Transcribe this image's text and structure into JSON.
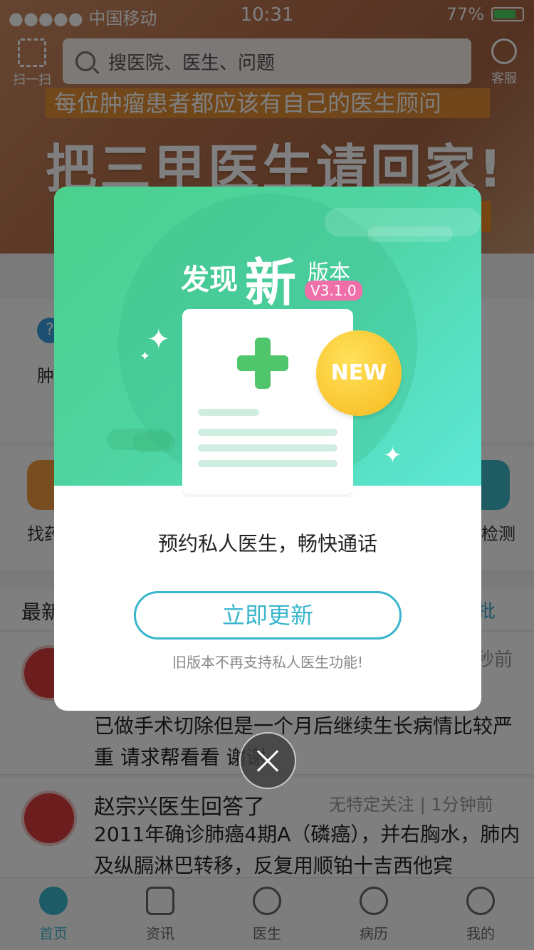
{
  "status": {
    "carrier": "●●●●● 中国移动",
    "time": "10:31",
    "battery": "77%"
  },
  "header": {
    "scan_label": "扫一扫",
    "search_placeholder": "搜医院、医生、问题",
    "service_label": "客服"
  },
  "banner": {
    "slogan": "每位肿瘤患者都应该有自己的医生顾问",
    "title": "把三甲医生请回家!"
  },
  "background": {
    "grid_label_partial": "肿",
    "find_label_partial": "找药",
    "detect_label": "检测",
    "section_title_partial": "最新",
    "refresh_label_partial": "批",
    "row1_time_partial": "秒前",
    "row1_text": "已做手术切除但是一个月后继续生长病情比较严重 请求帮看看 谢谢",
    "row2_title": "赵宗兴医生回答了",
    "row2_meta": "无特定关注 | 1分钟前",
    "row2_body": "2011年确诊肺癌4期A（磷癌），并右胸水，肺内及纵膈淋巴转移，反复用顺铂十吉西他宾"
  },
  "dialog": {
    "heading_find": "发现",
    "heading_new": "新",
    "heading_version_word": "版本",
    "version": "V3.1.0",
    "new_badge": "NEW",
    "message": "预约私人医生，畅快通话",
    "update_button": "立即更新",
    "note": "旧版本不再支持私人医生功能!"
  },
  "tabs": [
    {
      "label": "首页",
      "icon": "home-heart-icon"
    },
    {
      "label": "资讯",
      "icon": "news-icon"
    },
    {
      "label": "医生",
      "icon": "doctor-icon"
    },
    {
      "label": "病历",
      "icon": "medical-record-icon"
    },
    {
      "label": "我的",
      "icon": "profile-icon"
    }
  ],
  "colors": {
    "accent": "#3ab6cc",
    "hero_green": "#4bd08c",
    "badge_pink": "#f06fa8",
    "new_yellow": "#f7b91e"
  }
}
